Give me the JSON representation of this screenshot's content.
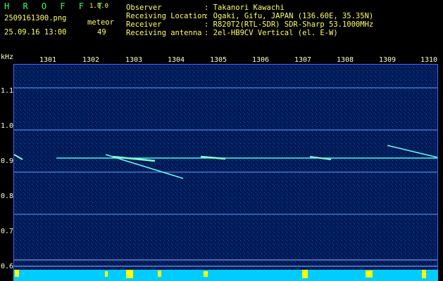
{
  "header": {
    "app_logo": "H R O F F T",
    "version": "1.0.0",
    "filename": "2509161300.png",
    "datetime": "25.09.16 13:00",
    "count_label": "meteor",
    "count_value": "49",
    "info": [
      {
        "key": "Observer",
        "value": ": Takanori Kawachi"
      },
      {
        "key": "Receiving Location",
        "value": ": Ogaki, Gifu, JAPAN (136.60E, 35.35N)"
      },
      {
        "key": "Receiver",
        "value": ": R820T2(RTL-SDR) SDR-Sharp 53.1000MHz"
      },
      {
        "key": "Receiving antenna",
        "value": ": 2el-HB9CV Vertical (el. E-W)"
      }
    ]
  },
  "axis": {
    "y_unit": "kHz",
    "x_ticks": [
      "1301",
      "1302",
      "1303",
      "1304",
      "1305",
      "1306",
      "1307",
      "1308",
      "1309",
      "1310"
    ],
    "y_ticks": [
      "1.1",
      "1.0",
      "0.9",
      "0.8",
      "0.7",
      "0.6"
    ]
  },
  "colors": {
    "background": "#000000",
    "spectrogram": "#001a55",
    "signal": "#00ffee",
    "label_yellow": "#ffff66",
    "band_bottom": "#00ccff",
    "spikes": "#ffff00"
  }
}
